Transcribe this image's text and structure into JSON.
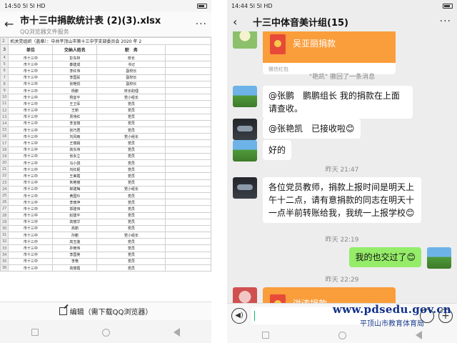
{
  "left": {
    "status_time": "14:50",
    "status_signal": "5l 5l HD",
    "title": "市十三中捐款统计表 (2)(3).xlsx",
    "subtitle": "QQ浏览器文件服务",
    "more": "···",
    "sheet": {
      "org_row_num": "2",
      "org_text": "机关党组织（盖章）：中共平顶山市第十三中学支部委员会 2020 年 2",
      "header_row_num": "3",
      "headers": [
        "单位",
        "交纳人姓名",
        "职　务"
      ],
      "row_nums": [
        "4",
        "5",
        "6",
        "7",
        "8",
        "9",
        "10",
        "11",
        "12",
        "13",
        "14",
        "15",
        "16",
        "17",
        "18",
        "19",
        "20",
        "21",
        "22",
        "23",
        "24",
        "25",
        "26",
        "27",
        "28",
        "29",
        "30",
        "31",
        "32",
        "33",
        "34",
        "35",
        "36"
      ],
      "rows": [
        [
          "市十三中",
          "彭东林",
          "校长"
        ],
        [
          "市十三中",
          "秦建成",
          "书记"
        ],
        [
          "市十三中",
          "李红伟",
          "副校长"
        ],
        [
          "市十三中",
          "李国民",
          "副校长"
        ],
        [
          "市十三中",
          "张艳凯",
          "副校长"
        ],
        [
          "市十三中",
          "杨鹏",
          "校长助理"
        ],
        [
          "市十三中",
          "杨宜平",
          "党小组长"
        ],
        [
          "市十三中",
          "王卫军",
          "党员"
        ],
        [
          "市十三中",
          "王丽",
          "党员"
        ],
        [
          "市十三中",
          "贾伟红",
          "党员"
        ],
        [
          "市十三中",
          "李亚丽",
          "党员"
        ],
        [
          "市十三中",
          "张巧君",
          "党员"
        ],
        [
          "市十三中",
          "刘风雨",
          "党小组长"
        ],
        [
          "市十三中",
          "王丽娟",
          "党员"
        ],
        [
          "市十三中",
          "高东伟",
          "党员"
        ],
        [
          "市十三中",
          "张永立",
          "党员"
        ],
        [
          "市十三中",
          "马小鸽",
          "党员"
        ],
        [
          "市十三中",
          "刘红妮",
          "党员"
        ],
        [
          "市十三中",
          "王美霞",
          "党员"
        ],
        [
          "市十三中",
          "朱艳丽",
          "党员"
        ],
        [
          "市十三中",
          "郎建梅",
          "党小组长"
        ],
        [
          "市十三中",
          "黄国玲",
          "党员"
        ],
        [
          "市十三中",
          "李丽萍",
          "党员"
        ],
        [
          "市十三中",
          "郭建伟",
          "党员"
        ],
        [
          "市十三中",
          "赵建平",
          "党员"
        ],
        [
          "市十三中",
          "高丽华",
          "党员"
        ],
        [
          "市十三中",
          "高丽",
          "党员"
        ],
        [
          "市十三中",
          "孙鹏",
          "党小组长"
        ],
        [
          "市十三中",
          "高玉莲",
          "党员"
        ],
        [
          "市十三中",
          "孙艳伟",
          "党员"
        ],
        [
          "市十三中",
          "李国英",
          "党员"
        ],
        [
          "市十三中",
          "李艳",
          "党员"
        ],
        [
          "市十三中",
          "高丽霞",
          "党员"
        ]
      ]
    },
    "edit_label": "编辑（需下载QQ浏览器）"
  },
  "right": {
    "status_time": "14:44",
    "status_signal": "5l 5l HD",
    "title": "十三中体音美计组(15)",
    "more": "···",
    "messages": {
      "redpack1_title": "吴亚丽捐款",
      "redpack1_foot": "微信红包",
      "recall": "\"艳凯\" 撤回了一条消息",
      "msg_zhangpeng": "@张鹏　鹏鹏组长 我的捐款在上面请查收。",
      "msg_received": "@张艳凯　已接收啦😊",
      "msg_good": "好的",
      "time1": "昨天 21:47",
      "msg_notice": "各位党员教师，捐款上报时间是明天上午十二点，请有意捐款的同志在明天十一点半前转账给我，我统一上报学校😊",
      "time2": "昨天 22:19",
      "msg_me": "我的也交过了😊",
      "time3": "昨天 22:29",
      "redpack2_title": "洪涛捐款"
    },
    "voice_glyph": "◀)",
    "plus_glyph": "+"
  },
  "watermark": {
    "url": "www.pdsedu.gov.cn",
    "name": "平顶山市教育体育局"
  }
}
